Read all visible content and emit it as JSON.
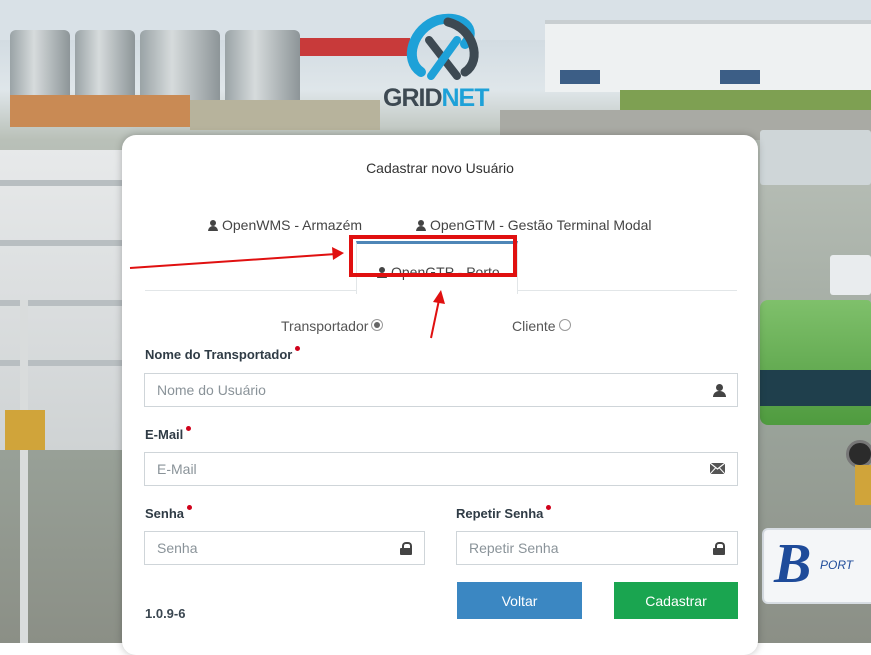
{
  "logo": {
    "text_part1": "GRID",
    "text_part2": "NET"
  },
  "card": {
    "title": "Cadastrar novo Usuário"
  },
  "tabs": [
    {
      "label": "OpenWMS - Armazém",
      "icon": "user-icon",
      "active": false
    },
    {
      "label": "OpenGTM - Gestão Terminal Modal",
      "icon": "user-icon",
      "active": false
    },
    {
      "label": "OpenGTP - Porto",
      "icon": "user-icon",
      "active": true
    }
  ],
  "user_type": {
    "options": [
      {
        "label": "Transportador",
        "checked": true
      },
      {
        "label": "Cliente",
        "checked": false
      }
    ]
  },
  "form": {
    "name": {
      "label": "Nome do Transportador",
      "placeholder": "Nome do Usuário",
      "value": ""
    },
    "email": {
      "label": "E-Mail",
      "placeholder": "E-Mail",
      "value": ""
    },
    "password": {
      "label": "Senha",
      "placeholder": "Senha",
      "value": ""
    },
    "repeat_password": {
      "label": "Repetir Senha",
      "placeholder": "Repetir Senha",
      "value": ""
    }
  },
  "buttons": {
    "back": "Voltar",
    "submit": "Cadastrar"
  },
  "version": "1.0.9-6",
  "port_sign": {
    "letter": "B",
    "text": "PORT"
  },
  "colors": {
    "back_button": "#3b87c2",
    "submit_button": "#1aa550",
    "active_tab_border": "#4e86b7",
    "required_dot": "#d0021b",
    "annotation": "#e01010"
  }
}
